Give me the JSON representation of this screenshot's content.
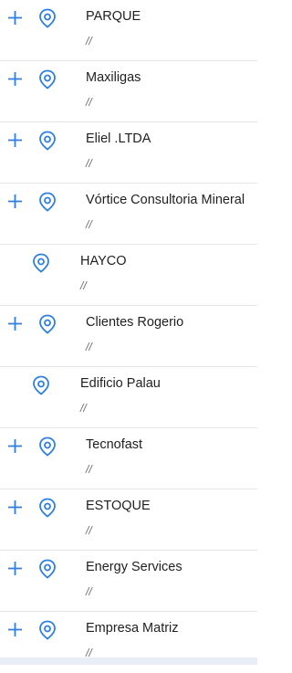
{
  "colors": {
    "accent": "#2e7fe0",
    "divider": "#e6e6e6",
    "text": "#1f1f1f",
    "subtext": "#6b6b6b"
  },
  "icons": {
    "add": "plus-icon",
    "location": "location-pin-icon"
  },
  "locations": [
    {
      "name": "PARQUE",
      "subtitle": "//",
      "has_add": true
    },
    {
      "name": "Maxiligas",
      "subtitle": "//",
      "has_add": true
    },
    {
      "name": "Eliel .LTDA",
      "subtitle": "//",
      "has_add": true
    },
    {
      "name": "Vórtice Consultoria Mineral",
      "subtitle": "//",
      "has_add": true
    },
    {
      "name": "HAYCO",
      "subtitle": "//",
      "has_add": false
    },
    {
      "name": "Clientes Rogerio",
      "subtitle": "//",
      "has_add": true
    },
    {
      "name": "Edificio Palau",
      "subtitle": "//",
      "has_add": false
    },
    {
      "name": "Tecnofast",
      "subtitle": "//",
      "has_add": true
    },
    {
      "name": "ESTOQUE",
      "subtitle": "//",
      "has_add": true
    },
    {
      "name": "Energy Services",
      "subtitle": "//",
      "has_add": true
    },
    {
      "name": "Empresa Matriz",
      "subtitle": "//",
      "has_add": true
    }
  ]
}
